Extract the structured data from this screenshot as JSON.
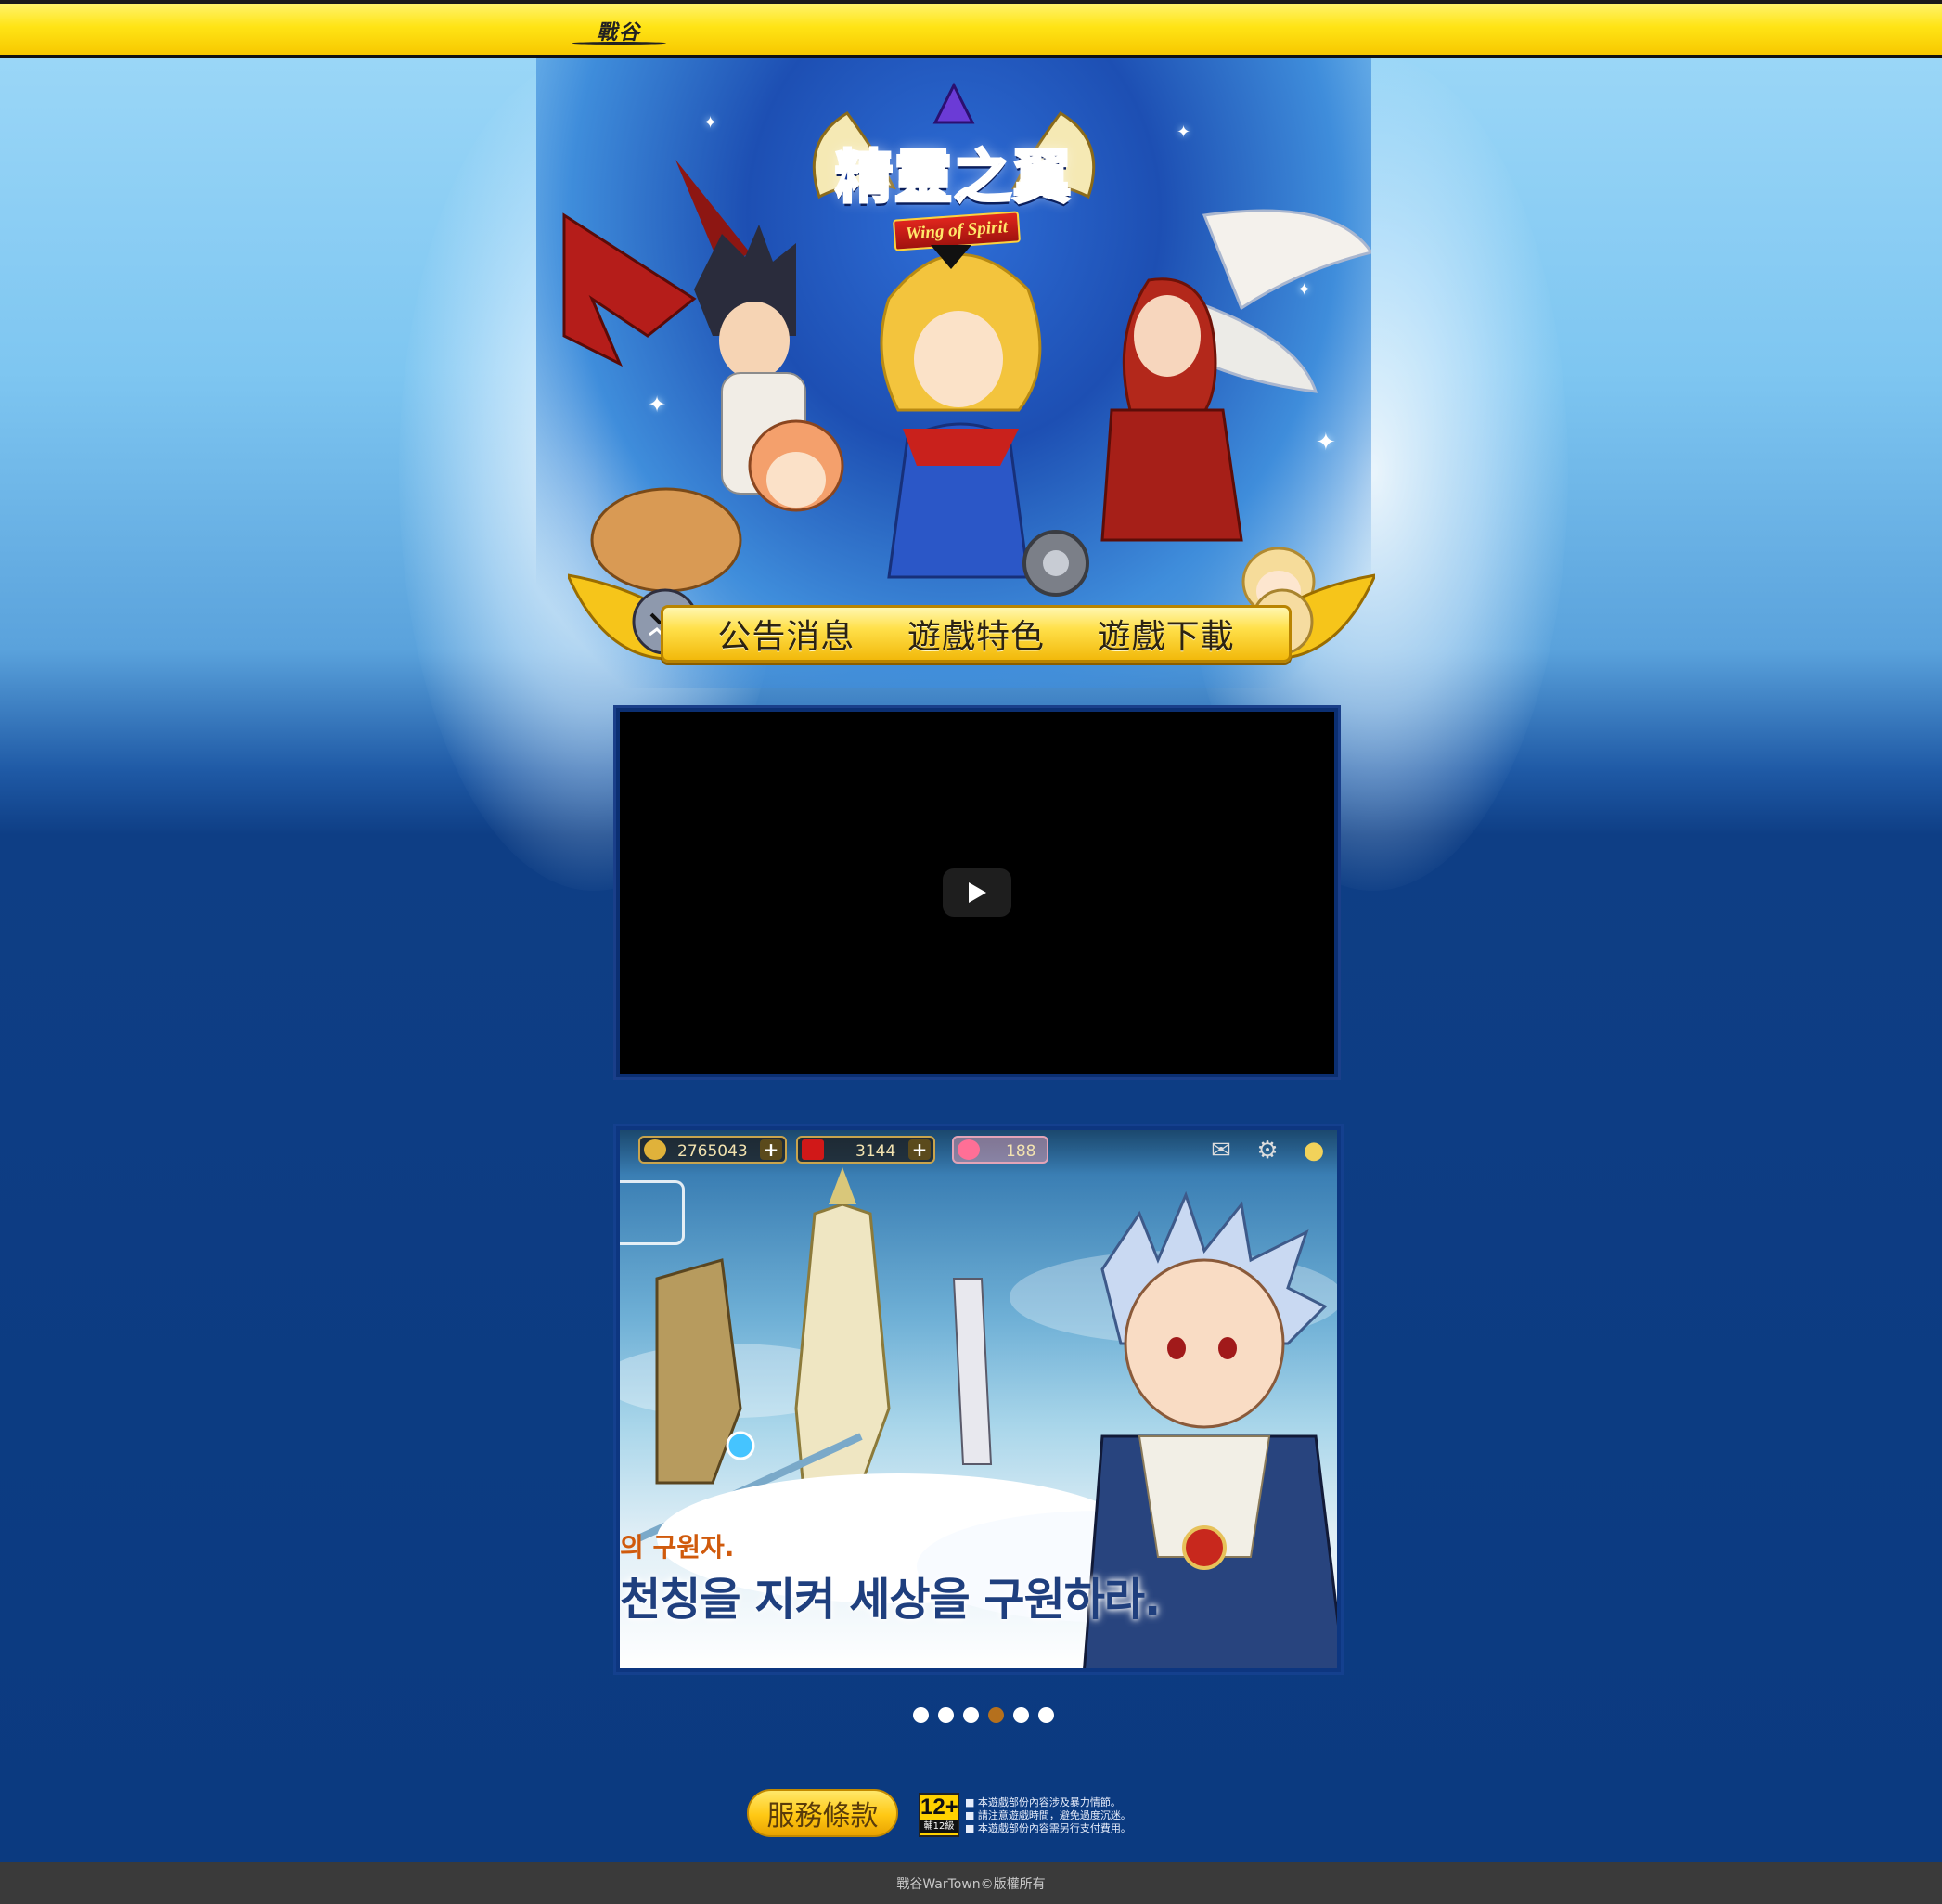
{
  "topbar": {
    "brand_logo_text": "戰谷"
  },
  "hero": {
    "game_title": "精靈之翼",
    "game_subtitle": "Wing of Spirit"
  },
  "nav": {
    "items": [
      {
        "label": "公告消息"
      },
      {
        "label": "遊戲特色"
      },
      {
        "label": "遊戲下載"
      }
    ]
  },
  "video": {
    "play_icon": "play-icon"
  },
  "screenshot": {
    "hud": {
      "gold": "2765043",
      "gems": "3144",
      "hearts": "188",
      "icons": [
        "coin-icon",
        "gem-icon",
        "heart-icon",
        "mail-icon",
        "gear-icon",
        "chat-icon"
      ]
    },
    "caption_small": "의 구원자.",
    "caption_big": "천칭을 지켜 세상을 구원하라."
  },
  "carousel": {
    "count": 6,
    "active_index": 3,
    "active_color": "#b5701d"
  },
  "footer": {
    "terms_label": "服務條款",
    "rating": {
      "number": "12+",
      "label": "輔12級"
    },
    "rating_notes": [
      "■ 本遊戲部份內容涉及暴力情節。",
      "■ 請注意遊戲時間，避免過度沉迷。",
      "■ 本遊戲部份內容需另行支付費用。"
    ],
    "copyright": "戰谷WarTown©版權所有"
  },
  "colors": {
    "topbar_yellow": "#ffe415",
    "background_blue": "#0b3a80",
    "sky_blue": "#9fd9f8",
    "footer_gray": "#3a3a3a"
  }
}
